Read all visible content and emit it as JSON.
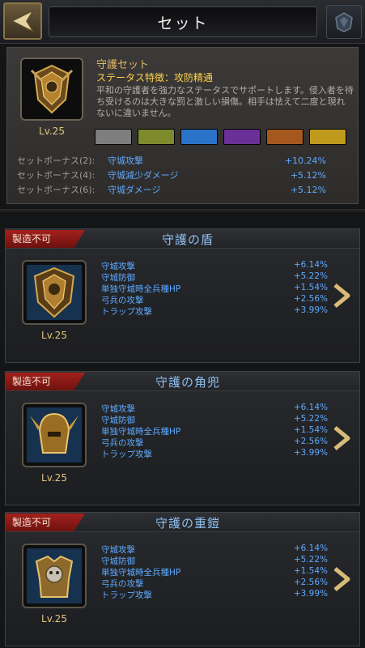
{
  "header": {
    "title": "セット"
  },
  "set": {
    "name": "守護セット",
    "feature": "ステータス特徴：攻防精通",
    "description": "平和の守護者を強力なステータスでサポートします。侵入者を待ち受けるのは大きな罰と激しい損傷。相手は怯えて二度と現れないに違いません。",
    "level": "Lv.25",
    "swatch_colors": [
      "#7e7e7e",
      "#7d8b2c",
      "#2a73c8",
      "#6b2f98",
      "#a5581e",
      "#c09a1c"
    ],
    "bonuses": [
      {
        "label": "セットボーナス(2):",
        "name": "守城攻撃",
        "value": "+10.24%"
      },
      {
        "label": "セットボーナス(4):",
        "name": "守城減少ダメージ",
        "value": "+5.12%"
      },
      {
        "label": "セットボーナス(6):",
        "name": "守城ダメージ",
        "value": "+5.12%"
      }
    ]
  },
  "items": [
    {
      "badge": "製造不可",
      "title": "守護の盾",
      "level": "Lv.25",
      "stats": [
        {
          "name": "守城攻撃",
          "value": "+6.14%"
        },
        {
          "name": "守城防御",
          "value": "+5.22%"
        },
        {
          "name": "単独守城時全兵種HP",
          "value": "+1.54%"
        },
        {
          "name": "弓兵の攻撃",
          "value": "+2.56%"
        },
        {
          "name": "トラップ攻撃",
          "value": "+3.99%"
        }
      ]
    },
    {
      "badge": "製造不可",
      "title": "守護の角兜",
      "level": "Lv.25",
      "stats": [
        {
          "name": "守城攻撃",
          "value": "+6.14%"
        },
        {
          "name": "守城防御",
          "value": "+5.22%"
        },
        {
          "name": "単独守城時全兵種HP",
          "value": "+1.54%"
        },
        {
          "name": "弓兵の攻撃",
          "value": "+2.56%"
        },
        {
          "name": "トラップ攻撃",
          "value": "+3.99%"
        }
      ]
    },
    {
      "badge": "製造不可",
      "title": "守護の重鎧",
      "level": "Lv.25",
      "stats": [
        {
          "name": "守城攻撃",
          "value": "+6.14%"
        },
        {
          "name": "守城防御",
          "value": "+5.22%"
        },
        {
          "name": "単独守城時全兵種HP",
          "value": "+1.54%"
        },
        {
          "name": "弓兵の攻撃",
          "value": "+2.56%"
        },
        {
          "name": "トラップ攻撃",
          "value": "+3.99%"
        }
      ]
    }
  ]
}
